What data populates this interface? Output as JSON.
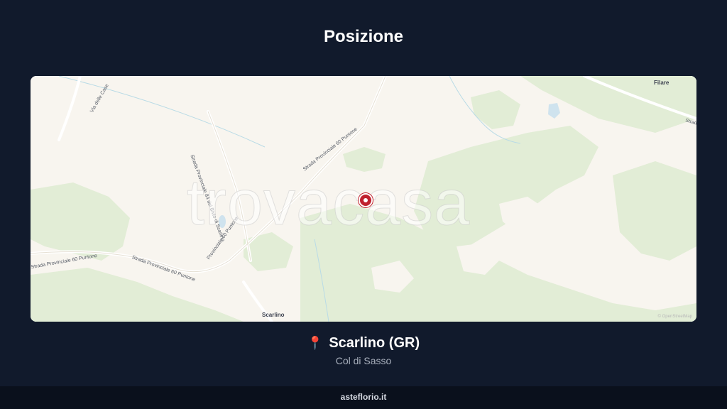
{
  "page": {
    "title": "Posizione"
  },
  "map": {
    "watermark": "trovacasa",
    "attribution": "© OpenStreetMap",
    "towns": [
      "Filare",
      "Scarlino"
    ],
    "roads": [
      "Strada Provinciale 60 Puntone",
      "Strada Provinciale 84 del Bivio di Scarlino",
      "Via delle Case",
      "Strada Provinciale 60 Puntone",
      "Provinciale 60 Puntone",
      "Strada Provinciale 60 Puntone",
      "Strada"
    ],
    "marker_color": "#c0212e"
  },
  "location": {
    "pin_icon": "pin-icon",
    "name": "Scarlino (GR)",
    "detail": "Col di Sasso"
  },
  "footer": {
    "text": "asteflorio.it"
  },
  "colors": {
    "background": "#111a2c",
    "footer": "#0a101c",
    "map_bg": "#f8f5ef",
    "forest": "#e2edd6"
  }
}
